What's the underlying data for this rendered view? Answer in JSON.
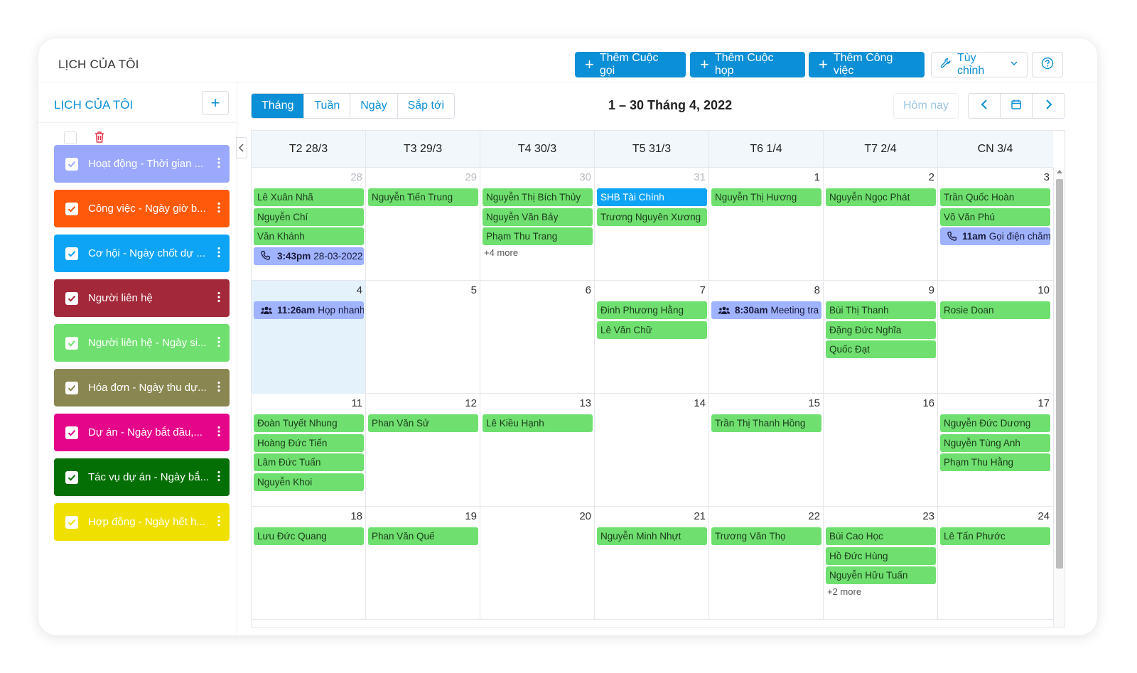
{
  "header": {
    "title": "LỊCH CỦA TÔI",
    "add_call": "Thêm Cuộc gọi",
    "add_meeting": "Thêm Cuộc họp",
    "add_task": "Thêm Công việc",
    "customize": "Tùy chỉnh"
  },
  "sidebar": {
    "title": "LỊCH CỦA TÔI",
    "items": [
      {
        "label": "Hoạt động - Thời gian ...",
        "color": "#9aa9fb"
      },
      {
        "label": "Công việc - Ngày giờ b...",
        "color": "#ff5a0a"
      },
      {
        "label": "Cơ hội - Ngày chốt dự ...",
        "color": "#0ea4f5"
      },
      {
        "label": "Người liên hệ",
        "color": "#a3283a"
      },
      {
        "label": "Người liên hệ - Ngày si...",
        "color": "#6fe06f"
      },
      {
        "label": "Hóa đơn - Ngày thu dự...",
        "color": "#8a8651"
      },
      {
        "label": "Dự án - Ngày bắt đầu,...",
        "color": "#e5058b"
      },
      {
        "label": "Tác vụ dự án - Ngày bắ...",
        "color": "#046f04"
      },
      {
        "label": "Hợp đồng - Ngày hết h...",
        "color": "#f0e000"
      }
    ]
  },
  "toolbar": {
    "tabs": [
      "Tháng",
      "Tuần",
      "Ngày",
      "Sắp tới"
    ],
    "active_tab": "Tháng",
    "range": "1 – 30 Tháng 4, 2022",
    "today": "Hôm nay"
  },
  "calendar": {
    "headers": [
      "T2 28/3",
      "T3 29/3",
      "T4 30/3",
      "T5 31/3",
      "T6 1/4",
      "T7 2/4",
      "CN 3/4"
    ],
    "weeks": [
      [
        {
          "num": "28",
          "other": true,
          "events": [
            {
              "text": "Lê Xuân Nhã",
              "type": "green"
            },
            {
              "text": "Nguyễn Chí",
              "type": "green"
            },
            {
              "text": "Văn Khánh",
              "type": "green"
            },
            {
              "time": "3:43pm",
              "text": "28-03-2022",
              "type": "lilac",
              "icon": "phone-icon"
            }
          ]
        },
        {
          "num": "29",
          "other": true,
          "events": [
            {
              "text": "Nguyễn Tiến Trung",
              "type": "green"
            }
          ]
        },
        {
          "num": "30",
          "other": true,
          "events": [
            {
              "text": "Nguyễn Thị Bích Thủy",
              "type": "green"
            },
            {
              "text": "Nguyễn Văn Bảy",
              "type": "green"
            },
            {
              "text": "Phạm Thu Trang",
              "type": "green"
            }
          ],
          "more": "+4 more"
        },
        {
          "num": "31",
          "other": true,
          "events": [
            {
              "text": "SHB Tài Chính",
              "type": "blue"
            },
            {
              "text": "Trương Nguyên Xương",
              "type": "green"
            }
          ]
        },
        {
          "num": "1",
          "events": [
            {
              "text": "Nguyễn Thị Hương",
              "type": "green"
            }
          ]
        },
        {
          "num": "2",
          "events": [
            {
              "text": "Nguyễn Ngọc Phát",
              "type": "green"
            }
          ]
        },
        {
          "num": "3",
          "events": [
            {
              "text": "Trần Quốc Hoàn",
              "type": "green"
            },
            {
              "text": "Võ Văn Phú",
              "type": "green"
            },
            {
              "time": "11am",
              "text": "Gọi điện chăm",
              "type": "lilac",
              "icon": "phone-icon"
            }
          ]
        }
      ],
      [
        {
          "num": "4",
          "today": true,
          "events": [
            {
              "time": "11:26am",
              "text": "Họp nhanh",
              "type": "lilac",
              "icon": "users-icon"
            }
          ]
        },
        {
          "num": "5",
          "events": []
        },
        {
          "num": "6",
          "events": []
        },
        {
          "num": "7",
          "events": [
            {
              "text": "Đinh Phương Hằng",
              "type": "green"
            },
            {
              "text": "Lê Văn Chữ",
              "type": "green"
            }
          ]
        },
        {
          "num": "8",
          "events": [
            {
              "time": "8:30am",
              "text": "Meeting tra",
              "type": "lilac",
              "icon": "users-icon"
            }
          ]
        },
        {
          "num": "9",
          "events": [
            {
              "text": "Bùi Thị Thanh",
              "type": "green"
            },
            {
              "text": "Đặng Đức Nghĩa",
              "type": "green"
            },
            {
              "text": "Quốc Đạt",
              "type": "green"
            }
          ]
        },
        {
          "num": "10",
          "events": [
            {
              "text": "Rosie Doan",
              "type": "green"
            }
          ]
        }
      ],
      [
        {
          "num": "11",
          "events": [
            {
              "text": "Đoàn Tuyết Nhung",
              "type": "green"
            },
            {
              "text": "Hoàng Đức Tiến",
              "type": "green"
            },
            {
              "text": "Lâm Đức Tuấn",
              "type": "green"
            },
            {
              "text": "Nguyễn Khoi",
              "type": "green"
            }
          ]
        },
        {
          "num": "12",
          "events": [
            {
              "text": "Phan Văn Sử",
              "type": "green"
            }
          ]
        },
        {
          "num": "13",
          "events": [
            {
              "text": "Lê Kiều Hạnh",
              "type": "green"
            }
          ]
        },
        {
          "num": "14",
          "events": []
        },
        {
          "num": "15",
          "events": [
            {
              "text": "Trần Thị Thanh Hồng",
              "type": "green"
            }
          ]
        },
        {
          "num": "16",
          "events": []
        },
        {
          "num": "17",
          "events": [
            {
              "text": "Nguyễn Đức Dương",
              "type": "green"
            },
            {
              "text": "Nguyễn Tùng Anh",
              "type": "green"
            },
            {
              "text": "Phạm Thu Hằng",
              "type": "green"
            }
          ]
        }
      ],
      [
        {
          "num": "18",
          "events": [
            {
              "text": "Lưu Đức Quang",
              "type": "green"
            }
          ]
        },
        {
          "num": "19",
          "events": [
            {
              "text": "Phan Văn Quế",
              "type": "green"
            }
          ]
        },
        {
          "num": "20",
          "events": []
        },
        {
          "num": "21",
          "events": [
            {
              "text": "Nguyễn Minh Nhựt",
              "type": "green"
            }
          ]
        },
        {
          "num": "22",
          "events": [
            {
              "text": "Trương Văn Thọ",
              "type": "green"
            }
          ]
        },
        {
          "num": "23",
          "events": [
            {
              "text": "Bùi Cao Học",
              "type": "green"
            },
            {
              "text": "Hồ Đức Hùng",
              "type": "green"
            },
            {
              "text": "Nguyễn Hữu Tuấn",
              "type": "green"
            }
          ],
          "more": "+2 more"
        },
        {
          "num": "24",
          "events": [
            {
              "text": "Lê Tấn Phước",
              "type": "green"
            }
          ]
        }
      ]
    ]
  }
}
